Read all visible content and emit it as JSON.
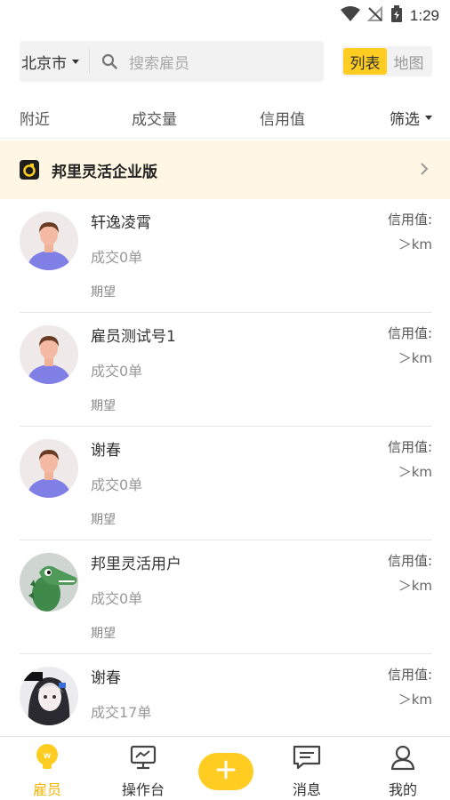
{
  "status_bar": {
    "time": "1:29",
    "icons": [
      "wifi-icon",
      "no-signal-icon",
      "battery-icon"
    ]
  },
  "search": {
    "city": "北京市",
    "placeholder": "搜索雇员"
  },
  "view_toggle": {
    "list_label": "列表",
    "map_label": "地图",
    "active": "list"
  },
  "filters": {
    "nearby": "附近",
    "volume": "成交量",
    "credit": "信用值",
    "filter": "筛选"
  },
  "banner": {
    "title": "邦里灵活企业版"
  },
  "employees": [
    {
      "name": "轩逸凌霄",
      "deals": "成交0单",
      "expect": "期望",
      "credit": "信用值:",
      "distance": "＞km",
      "avatar": "default-person"
    },
    {
      "name": "雇员测试号1",
      "deals": "成交0单",
      "expect": "期望",
      "credit": "信用值:",
      "distance": "＞km",
      "avatar": "default-person"
    },
    {
      "name": "谢春",
      "deals": "成交0单",
      "expect": "期望",
      "credit": "信用值:",
      "distance": "＞km",
      "avatar": "default-person"
    },
    {
      "name": "邦里灵活用户",
      "deals": "成交0单",
      "expect": "期望",
      "credit": "信用值:",
      "distance": "＞km",
      "avatar": "cartoon-crocodile"
    },
    {
      "name": "谢春",
      "deals": "成交17单",
      "expect": "期望",
      "credit": "信用值:",
      "distance": "＞km",
      "avatar": "anime-girl"
    }
  ],
  "tabbar": {
    "employees": "雇员",
    "workbench": "操作台",
    "messages": "消息",
    "mine": "我的",
    "active": "employees"
  },
  "colors": {
    "accent": "#ffcc22",
    "active_tab": "#f5b400",
    "banner_bg": "#fff7e3"
  }
}
